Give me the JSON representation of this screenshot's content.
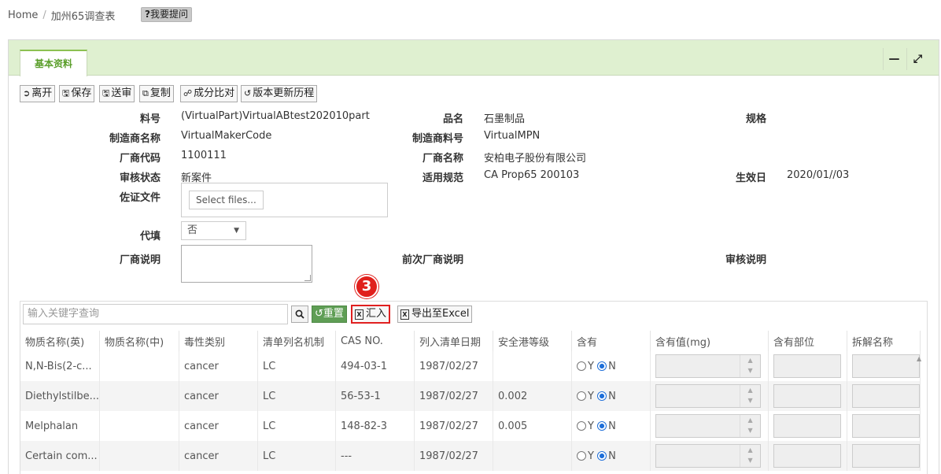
{
  "breadcrumb": {
    "home": "Home",
    "sep": "/",
    "current": "加州65调查表"
  },
  "ask_button": {
    "mark": "?",
    "label": "我要提问"
  },
  "tab": {
    "label": "基本资料"
  },
  "toolbar": {
    "leave": "离开",
    "save": "保存",
    "submit": "送审",
    "copy": "复制",
    "compare": "成分比对",
    "history": "版本更新历程"
  },
  "form": {
    "part_no_label": "料号",
    "part_no": "(VirtualPart)VirtualABtest202010part",
    "product_name_label": "品名",
    "product_name": "石墨制品",
    "spec_label": "规格",
    "maker_name_label": "制造商名称",
    "maker_name": "VirtualMakerCode",
    "maker_pn_label": "制造商料号",
    "maker_pn": "VirtualMPN",
    "vendor_code_label": "厂商代码",
    "vendor_code": "1100111",
    "vendor_name_label": "厂商名称",
    "vendor_name": "安柏电子股份有限公司",
    "review_status_label": "审核状态",
    "review_status": "新案件",
    "regulation_label": "适用规范",
    "regulation": "CA Prop65 200103",
    "effective_date_label": "生效日",
    "effective_date": "2020/01//03",
    "evidence_label": "佐证文件",
    "select_files": "Select files...",
    "proxy_label": "代填",
    "proxy_value": "否",
    "vendor_note_label": "厂商说明",
    "prev_vendor_note_label": "前次厂商说明",
    "review_note_label": "审核说明"
  },
  "grid": {
    "search_placeholder": "输入关键字查询",
    "reset": "重置",
    "import": "汇入",
    "export": "导出至Excel",
    "step_marker": "3",
    "columns": [
      "物质名称(英)",
      "物质名称(中)",
      "毒性类别",
      "清单列名机制",
      "CAS NO.",
      "列入清单日期",
      "安全港等级",
      "含有",
      "含有值(mg)",
      "含有部位",
      "拆解名称"
    ],
    "radio_y": "Y",
    "radio_n": "N",
    "rows": [
      {
        "name_en": "N,N-Bis(2-c...",
        "name_zh": "",
        "tox": "cancer",
        "mech": "LC",
        "cas": "494-03-1",
        "date": "1987/02/27",
        "level": ""
      },
      {
        "name_en": "Diethylstilbe...",
        "name_zh": "",
        "tox": "cancer",
        "mech": "LC",
        "cas": "56-53-1",
        "date": "1987/02/27",
        "level": "0.002"
      },
      {
        "name_en": "Melphalan",
        "name_zh": "",
        "tox": "cancer",
        "mech": "LC",
        "cas": "148-82-3",
        "date": "1987/02/27",
        "level": "0.005"
      },
      {
        "name_en": "Certain com...",
        "name_zh": "",
        "tox": "cancer",
        "mech": "LC",
        "cas": "---",
        "date": "1987/02/27",
        "level": ""
      }
    ]
  },
  "colors": {
    "accent_green": "#5a9e2a",
    "header_bg": "#dff0d0",
    "highlight_red": "#e02020"
  }
}
